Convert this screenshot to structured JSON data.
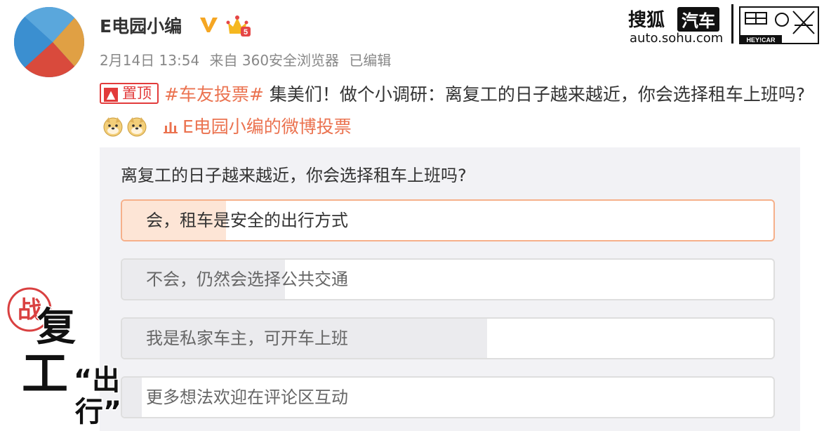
{
  "author": {
    "name": "E电园小编"
  },
  "meta": {
    "date": "2月14日 13:54",
    "source": "来自 360安全浏览器",
    "edited": "已编辑"
  },
  "brand": {
    "name_a": "搜狐",
    "name_b": "汽车",
    "domain": "auto.sohu.com",
    "logo_text": "HEY!CAR"
  },
  "post": {
    "pin_label": "置顶",
    "hashtag": "#车友投票#",
    "body": "集美们！做个小调研：离复工的日子越来越近，你会选择租车上班吗?",
    "poll_link": "E电园小编的微博投票",
    "poll_icon": "poll-icon"
  },
  "poll": {
    "question": "离复工的日子越来越近，你会选择租车上班吗?",
    "options": [
      {
        "label": "会，租车是安全的出行方式",
        "share": 0.16,
        "selected": true
      },
      {
        "label": "不会，仍然会选择公共交通",
        "share": 0.25,
        "selected": false
      },
      {
        "label": "我是私家车主，可开车上班",
        "share": 0.56,
        "selected": false
      },
      {
        "label": "更多想法欢迎在评论区互动",
        "share": 0.03,
        "selected": false
      }
    ]
  },
  "stamp": {
    "chars": [
      "战",
      "复",
      "工",
      "“出",
      "行”"
    ]
  },
  "colors": {
    "accent": "#eb7350",
    "pin_red": "#e23b3b",
    "verified": "#f5a623"
  }
}
